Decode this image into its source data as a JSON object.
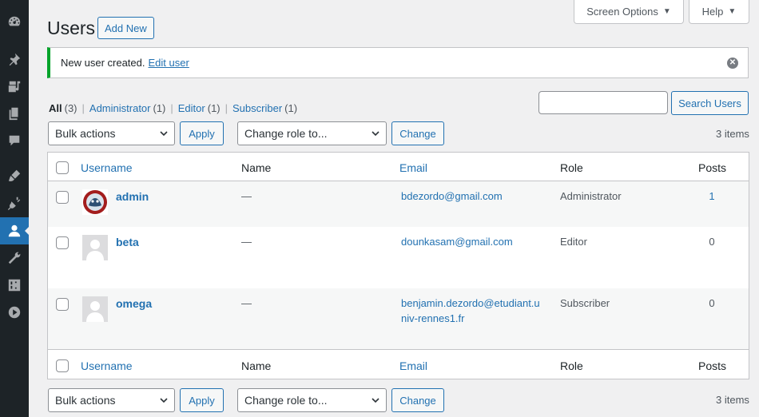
{
  "sidebar": {
    "items": [
      {
        "icon": "dashboard-icon"
      },
      {
        "icon": "pin-icon"
      },
      {
        "icon": "media-icon"
      },
      {
        "icon": "pages-icon"
      },
      {
        "icon": "comments-icon"
      },
      {
        "icon": "appearance-icon"
      },
      {
        "icon": "plugins-icon"
      },
      {
        "icon": "users-icon",
        "active": true
      },
      {
        "icon": "tools-icon"
      },
      {
        "icon": "settings-icon"
      },
      {
        "icon": "play-icon"
      }
    ]
  },
  "header": {
    "screen_options": "Screen Options",
    "help": "Help",
    "title": "Users",
    "add_new": "Add New"
  },
  "notice": {
    "text": "New user created.",
    "link": "Edit user"
  },
  "views": {
    "all": {
      "label": "All",
      "count": "(3)"
    },
    "administrator": {
      "label": "Administrator",
      "count": "(1)"
    },
    "editor": {
      "label": "Editor",
      "count": "(1)"
    },
    "subscriber": {
      "label": "Subscriber",
      "count": "(1)"
    },
    "separator": "|"
  },
  "search": {
    "value": "",
    "button": "Search Users"
  },
  "top_nav": {
    "bulk_actions": "Bulk actions",
    "apply": "Apply",
    "change_role": "Change role to...",
    "change": "Change",
    "items": "3 items"
  },
  "bottom_nav": {
    "bulk_actions": "Bulk actions",
    "apply": "Apply",
    "change_role": "Change role to...",
    "change": "Change",
    "items": "3 items"
  },
  "table": {
    "columns": {
      "username": "Username",
      "name": "Name",
      "email": "Email",
      "role": "Role",
      "posts": "Posts"
    },
    "rows": [
      {
        "username": "admin",
        "name": "—",
        "email_1": "bdezordo@gmail.com",
        "email_2": "",
        "role": "Administrator",
        "posts": "1",
        "avatar": "custom"
      },
      {
        "username": "beta",
        "name": "—",
        "email_1": "dounkasam@gmail.com",
        "email_2": "",
        "role": "Editor",
        "posts": "0",
        "avatar": "default"
      },
      {
        "username": "omega",
        "name": "—",
        "email_1": "benjamin.dezordo@etudiant.u",
        "email_2": "niv-rennes1.fr",
        "role": "Subscriber",
        "posts": "0",
        "avatar": "default"
      }
    ]
  },
  "colors": {
    "accent": "#2271b1",
    "sidebar": "#1d2327",
    "success": "#00a32a"
  }
}
